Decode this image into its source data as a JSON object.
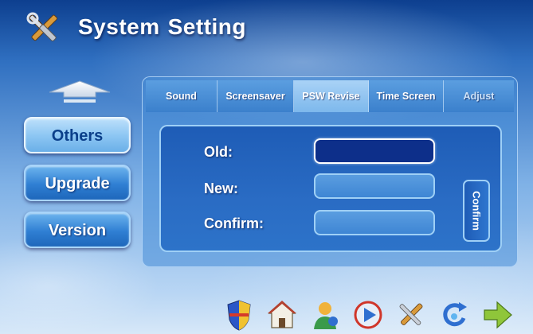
{
  "header": {
    "title_word1": "System",
    "title_word2": "Setting",
    "icon": "tools-icon"
  },
  "sidebar": {
    "up_icon": "up-arrow-icon",
    "items": [
      {
        "label": "Others",
        "active": true
      },
      {
        "label": "Upgrade",
        "active": false
      },
      {
        "label": "Version",
        "active": false
      }
    ]
  },
  "tabs": [
    {
      "label": "Sound"
    },
    {
      "label": "Screensaver"
    },
    {
      "label": "PSW Revise",
      "active": true
    },
    {
      "label": "Time Screen"
    },
    {
      "label": "Adjust"
    }
  ],
  "form": {
    "old_label": "Old:",
    "new_label": "New:",
    "confirm_label": "Confirm:",
    "old_value": "",
    "new_value": "",
    "confirm_value": "",
    "confirm_button": "Confirm"
  },
  "dock": {
    "icons": [
      "shield-icon",
      "home-icon",
      "user-icon",
      "play-icon",
      "tools-icon",
      "refresh-icon",
      "arrow-right-icon"
    ]
  },
  "colors": {
    "accent": "#2f7fd3",
    "focused_field": "#0d2f8a",
    "background_top": "#0d3f8f"
  }
}
